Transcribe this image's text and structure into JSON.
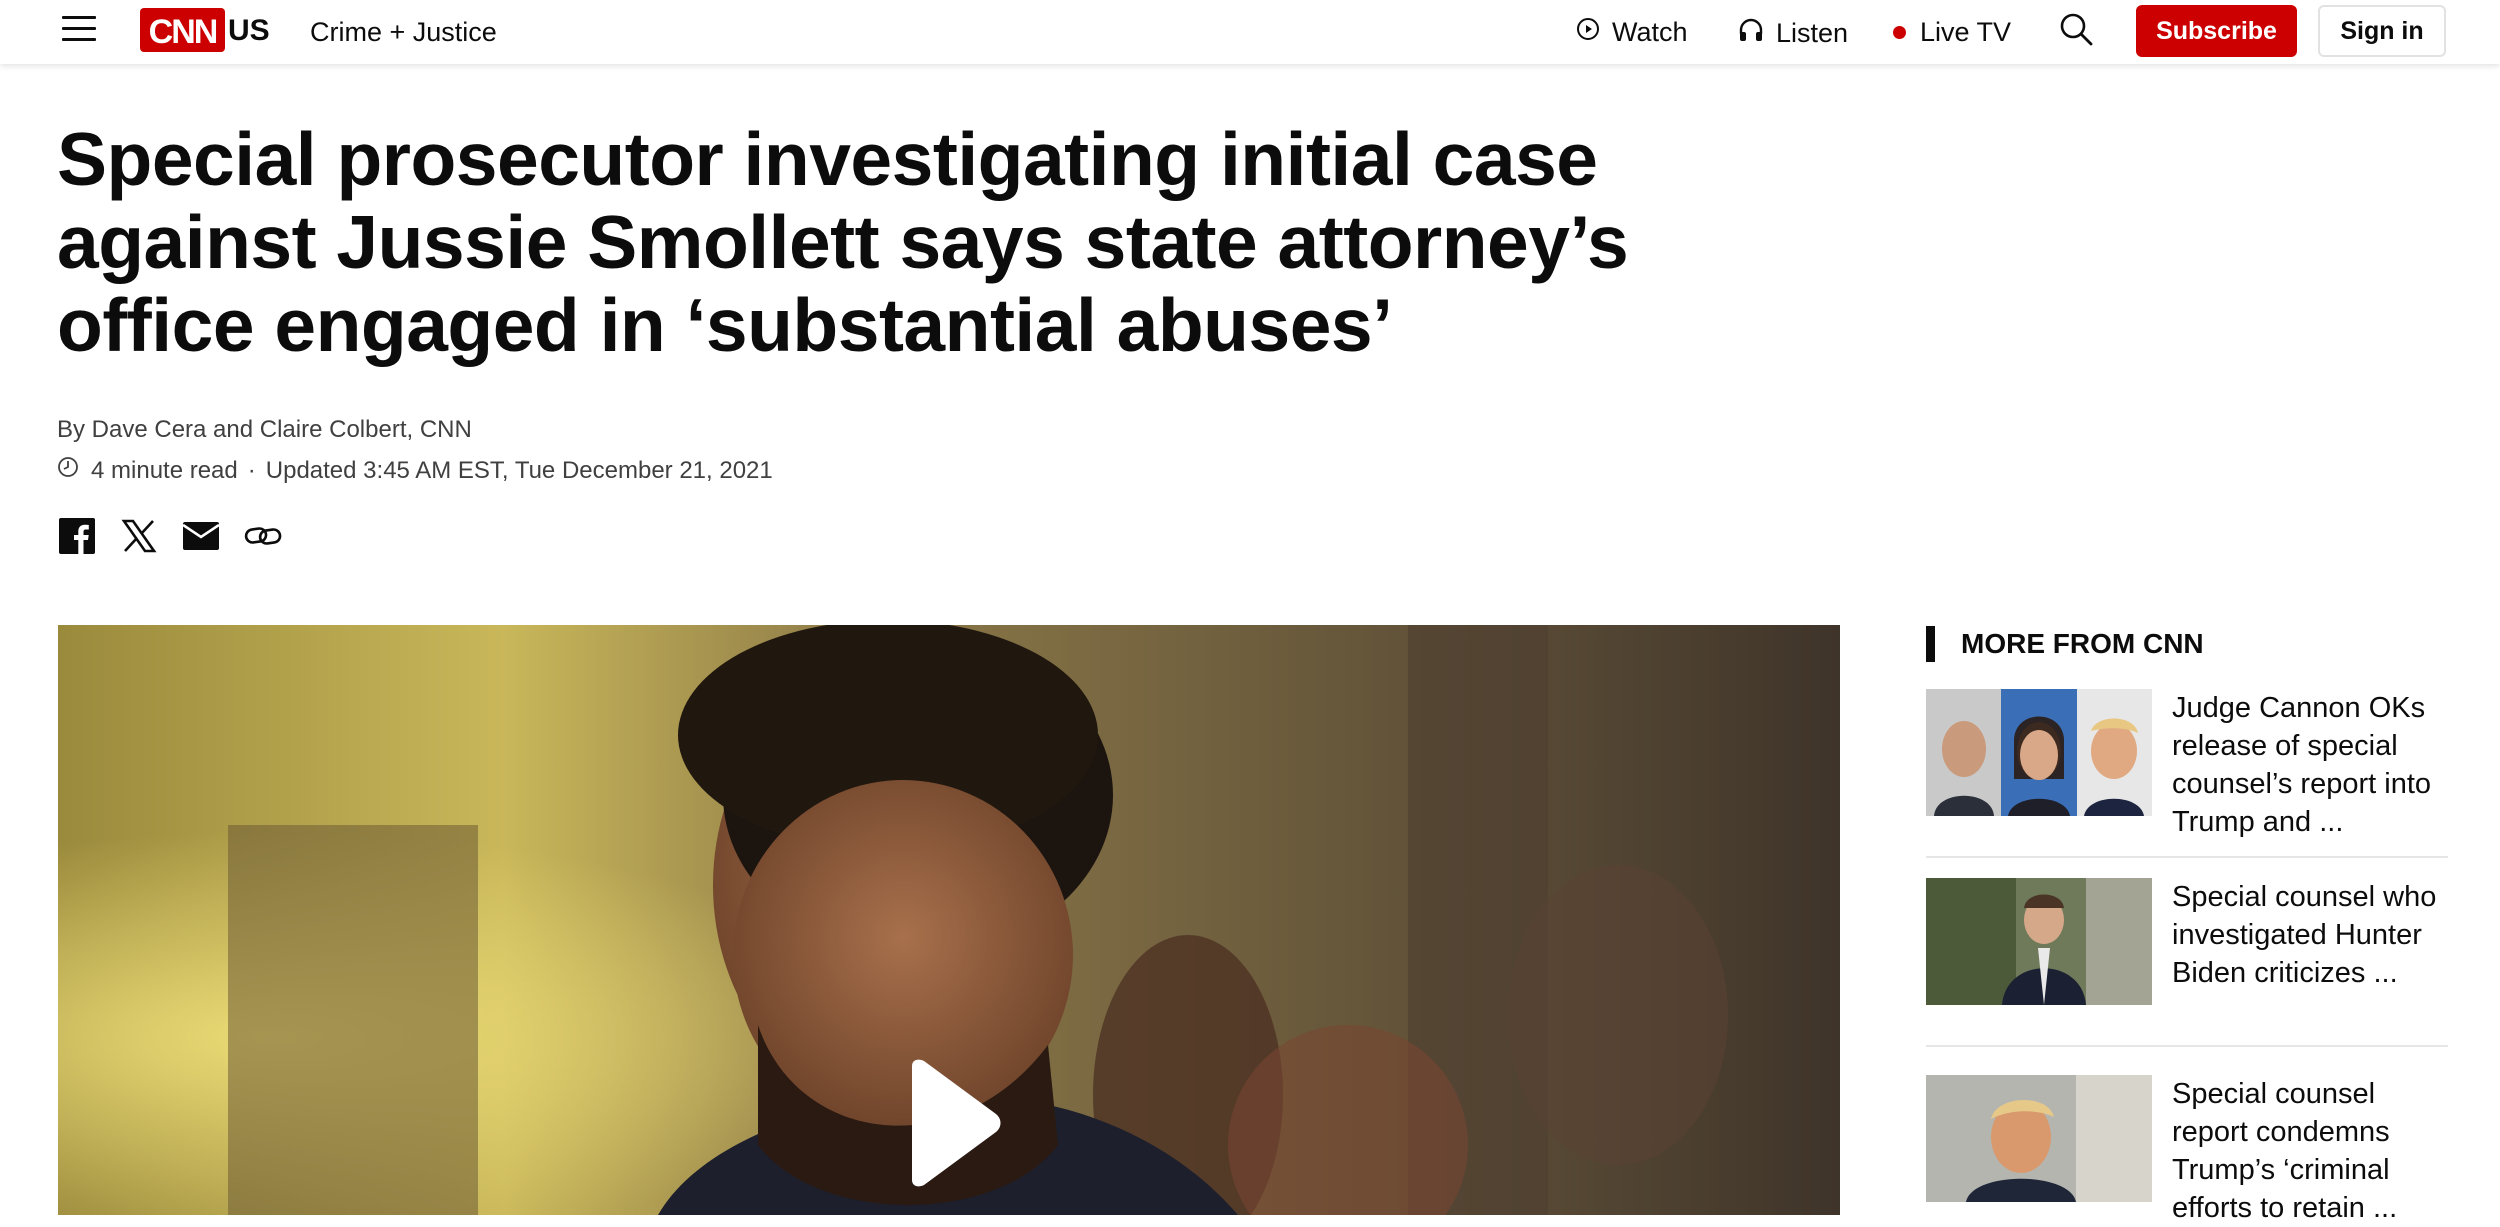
{
  "header": {
    "logo_text": "CNN",
    "edition": "US",
    "section": "Crime + Justice",
    "watch": "Watch",
    "listen": "Listen",
    "live_tv": "Live TV",
    "subscribe": "Subscribe",
    "sign_in": "Sign in"
  },
  "article": {
    "headline": "Special prosecutor investigating initial case against Jussie Smollett says state attorney’s office engaged in ‘substantial abuses’",
    "byline": "By Dave Cera and Claire Colbert, CNN",
    "read_time": "4 minute read",
    "separator": "·",
    "updated": "Updated 3:45 AM EST, Tue December 21, 2021"
  },
  "share_icons": [
    "facebook-icon",
    "x-icon",
    "email-icon",
    "link-icon"
  ],
  "sidebar": {
    "title": "MORE FROM CNN",
    "items": [
      {
        "text": "Judge Cannon OKs release of special counsel’s report into Trump and ..."
      },
      {
        "text": "Special counsel who investigated Hunter Biden criticizes ..."
      },
      {
        "text": "Special counsel report condemns Trump’s ‘criminal efforts to retain ..."
      }
    ]
  },
  "colors": {
    "brand_red": "#cc0000",
    "text": "#0c0c0c",
    "muted": "#404040"
  }
}
